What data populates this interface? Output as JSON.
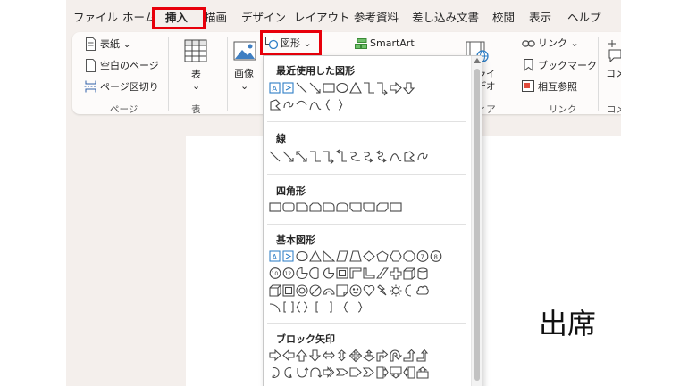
{
  "menu_tabs": [
    "ファイル",
    "ホーム",
    "挿入",
    "描画",
    "デザイン",
    "レイアウト",
    "参考資料",
    "差し込み文書",
    "校閲",
    "表示",
    "ヘルプ"
  ],
  "active_tab": "挿入",
  "highlight_color": "#e8000b",
  "ribbon": {
    "pages_group": {
      "cover_page": "表紙",
      "blank_page": "空白のページ",
      "page_break": "ページ区切り",
      "label": "ページ"
    },
    "table_group": {
      "table_button": "表",
      "label": "表"
    },
    "illustrations": {
      "picture": "画像",
      "shapes": "図形",
      "smartart": "SmartArt"
    },
    "media_group": {
      "online_video_line1": "ンライ",
      "online_video_line2": "ビデオ",
      "label": "ディア"
    },
    "links_group": {
      "link": "リンク",
      "bookmark": "ブックマーク",
      "cross_reference": "相互参照",
      "label": "リンク"
    },
    "comments_group": {
      "comment": "コメ",
      "label": "コメ"
    }
  },
  "shapes_dropdown": {
    "sections": [
      {
        "title": "最近使用した図形"
      },
      {
        "title": "線"
      },
      {
        "title": "四角形"
      },
      {
        "title": "基本図形"
      },
      {
        "title": "ブロック矢印"
      }
    ]
  },
  "document": {
    "text": "出席"
  }
}
